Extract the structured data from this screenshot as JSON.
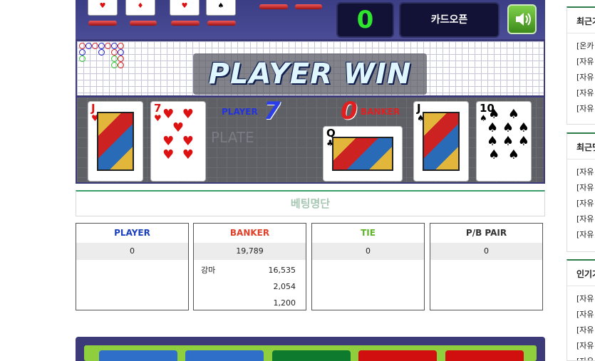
{
  "game": {
    "score_display": "0",
    "card_open_label": "카드오픈",
    "result_banner": "PLAYER WIN",
    "plate_text": "PLATE",
    "player": {
      "label": "PLAYER",
      "score": "7"
    },
    "banker": {
      "label": "BANKER",
      "score": "0"
    },
    "player_cards": [
      {
        "rank": "J",
        "suit": "♥",
        "color": "red"
      },
      {
        "rank": "7",
        "suit": "♥",
        "color": "red"
      }
    ],
    "banker_cards": [
      {
        "rank": "Q",
        "suit": "♣",
        "color": "black"
      },
      {
        "rank": "J",
        "suit": "♠",
        "color": "black"
      },
      {
        "rank": "10",
        "suit": "♠",
        "color": "black"
      }
    ],
    "top_mini_cards": [
      "♥",
      "♦",
      "♥",
      "♠"
    ]
  },
  "betting": {
    "title": "베팅명단",
    "columns": [
      {
        "header": "PLAYER",
        "color": "#1a3fbf",
        "total": "0",
        "rows": []
      },
      {
        "header": "BANKER",
        "color": "#e0402a",
        "total": "19,789",
        "rows": [
          {
            "name": "강마",
            "amount": "16,535"
          },
          {
            "name": "",
            "amount": "2,054"
          },
          {
            "name": "",
            "amount": "1,200"
          }
        ]
      },
      {
        "header": "TIE",
        "color": "#5fb52a",
        "total": "0",
        "rows": []
      },
      {
        "header": "P/B PAIR",
        "color": "#333333",
        "total": "0",
        "rows": []
      }
    ]
  },
  "chips": [
    "#2f6fc9",
    "#2f6fc9",
    "#0d7a2e",
    "#d10f0f",
    "#d10f0f"
  ],
  "sidebar": {
    "boxes": [
      {
        "title": "최근거",
        "items": [
          "[온카",
          "[자유",
          "[자유",
          "[자유",
          "[자유"
        ]
      },
      {
        "title": "최근댓",
        "items": [
          "[자유",
          "[자유",
          "[자유",
          "[자유",
          "[자유"
        ]
      },
      {
        "title": "인기거",
        "items": [
          "[자유",
          "[자유",
          "[자유",
          "[자유",
          "[자유"
        ]
      }
    ]
  }
}
